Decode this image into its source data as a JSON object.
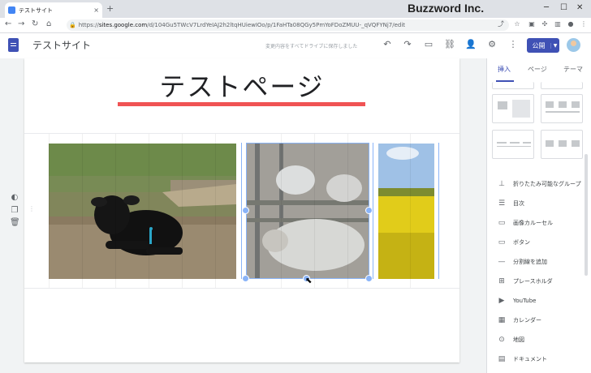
{
  "browser": {
    "tab_title": "テストサイト",
    "tab_close": "×",
    "new_tab": "+",
    "url_prefix": "https://",
    "url_domain": "sites.google.com",
    "url_path": "/d/104Gu5TWcV7LrdYeIAJ2h2ltqHUiewIOo/p/1FaHTa08QGy5PmYoFDoZMUU-_qVQFYNj7/edit",
    "window_brand": "Buzzword Inc."
  },
  "sites_header": {
    "site_name": "テストサイト",
    "save_status": "変更内容をすべてドライブに保存しました",
    "publish_label": "公開"
  },
  "page": {
    "title": "テストページ",
    "accent_color": "#f05354"
  },
  "panel": {
    "tabs": [
      "挿入",
      "ページ",
      "テーマ"
    ],
    "items": [
      {
        "icon": "collapsible-group-icon",
        "label": "折りたたみ可能なグループ"
      },
      {
        "icon": "toc-icon",
        "label": "目次"
      },
      {
        "icon": "carousel-icon",
        "label": "画像カルーセル"
      },
      {
        "icon": "button-icon",
        "label": "ボタン"
      },
      {
        "icon": "divider-icon",
        "label": "分割線を追加"
      },
      {
        "icon": "placeholder-icon",
        "label": "プレースホルダ"
      },
      {
        "icon": "youtube-icon",
        "label": "YouTube"
      },
      {
        "icon": "calendar-icon",
        "label": "カレンダー"
      },
      {
        "icon": "map-icon",
        "label": "地図"
      },
      {
        "icon": "document-icon",
        "label": "ドキュメント"
      }
    ]
  },
  "colors": {
    "brand": "#3f51b5",
    "selection": "#8ab4f8"
  }
}
